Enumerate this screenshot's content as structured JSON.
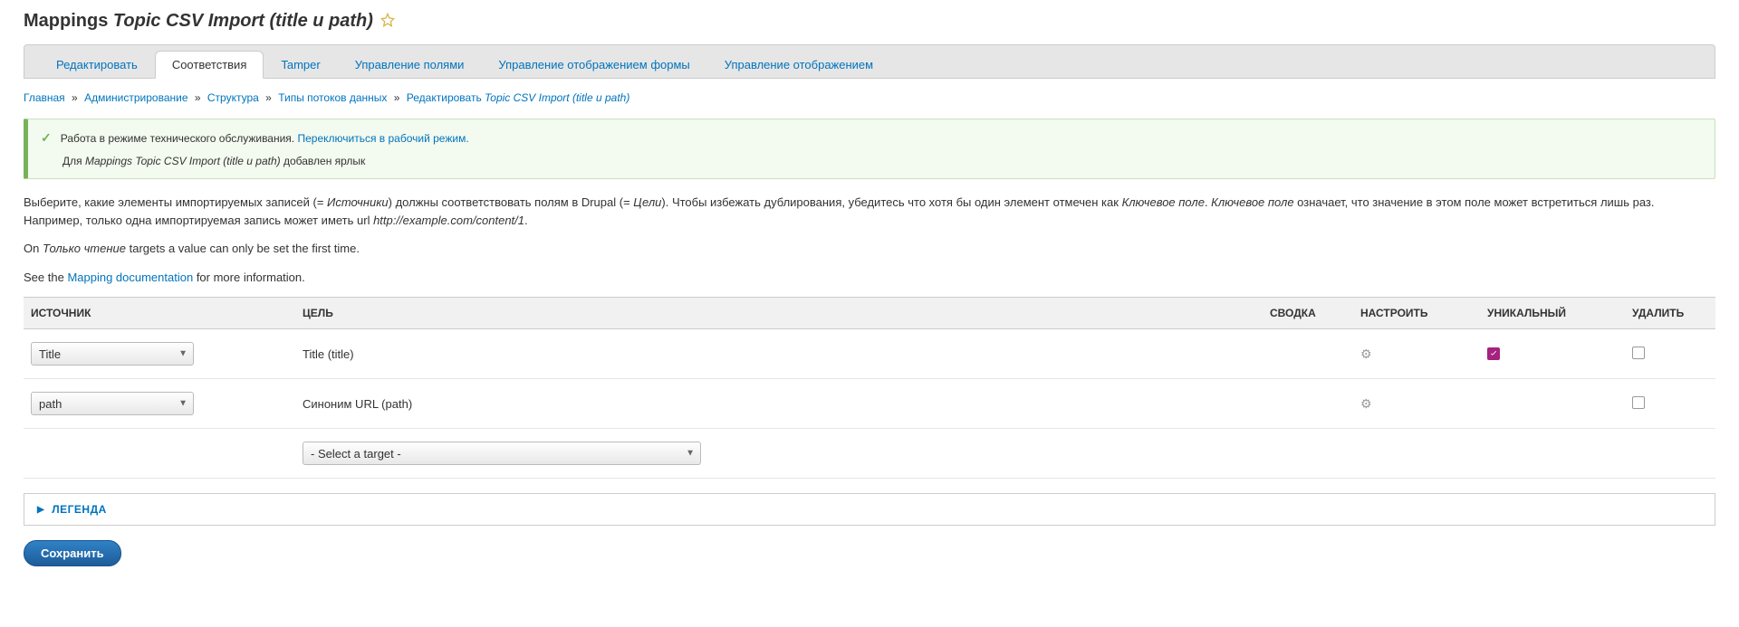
{
  "page_title_prefix": "Mappings",
  "page_title_italic": "Topic CSV Import (title и path)",
  "tabs": [
    {
      "label": "Редактировать",
      "active": false
    },
    {
      "label": "Соответствия",
      "active": true
    },
    {
      "label": "Tamper",
      "active": false
    },
    {
      "label": "Управление полями",
      "active": false
    },
    {
      "label": "Управление отображением формы",
      "active": false
    },
    {
      "label": "Управление отображением",
      "active": false
    }
  ],
  "breadcrumb": {
    "items": [
      "Главная",
      "Администрирование",
      "Структура",
      "Типы потоков данных"
    ],
    "last_prefix": "Редактировать",
    "last_italic": "Topic CSV Import (title и path)",
    "sep": "»"
  },
  "messages": {
    "line1_text": "Работа в режиме технического обслуживания.",
    "line1_link": "Переключиться в рабочий режим.",
    "line2_prefix": "Для",
    "line2_italic": "Mappings Topic CSV Import (title и path)",
    "line2_suffix": "добавлен ярлык"
  },
  "intro": {
    "p1_a": "Выберите, какие элементы импортируемых записей (= ",
    "p1_b": "Источники",
    "p1_c": ") должны соответствовать полям в Drupal (= ",
    "p1_d": "Цели",
    "p1_e": "). Чтобы избежать дублирования, убедитесь что хотя бы один элемент отмечен как ",
    "p1_f": "Ключевое поле",
    "p1_g": ". ",
    "p1_h": "Ключевое поле",
    "p1_i": " означает, что значение в этом поле может встретиться лишь раз. Например, только одна импортируемая запись может иметь url ",
    "p1_j": "http://example.com/content/1",
    "p1_k": ".",
    "p2_a": "On ",
    "p2_b": "Только чтение",
    "p2_c": " targets a value can only be set the first time.",
    "p3_a": "See the ",
    "p3_link": "Mapping documentation",
    "p3_b": " for more information."
  },
  "table": {
    "headers": {
      "source": "ИСТОЧНИК",
      "target": "ЦЕЛЬ",
      "summary": "СВОДКА",
      "configure": "НАСТРОИТЬ",
      "unique": "УНИКАЛЬНЫЙ",
      "delete": "УДАЛИТЬ"
    },
    "rows": [
      {
        "source": "Title",
        "target": "Title (title)",
        "unique_checked": true
      },
      {
        "source": "path",
        "target": "Синоним URL (path)",
        "unique_checked": false
      }
    ],
    "add_target_placeholder": "- Select a target -"
  },
  "legend_label": "ЛЕГЕНДА",
  "save_button": "Сохранить"
}
